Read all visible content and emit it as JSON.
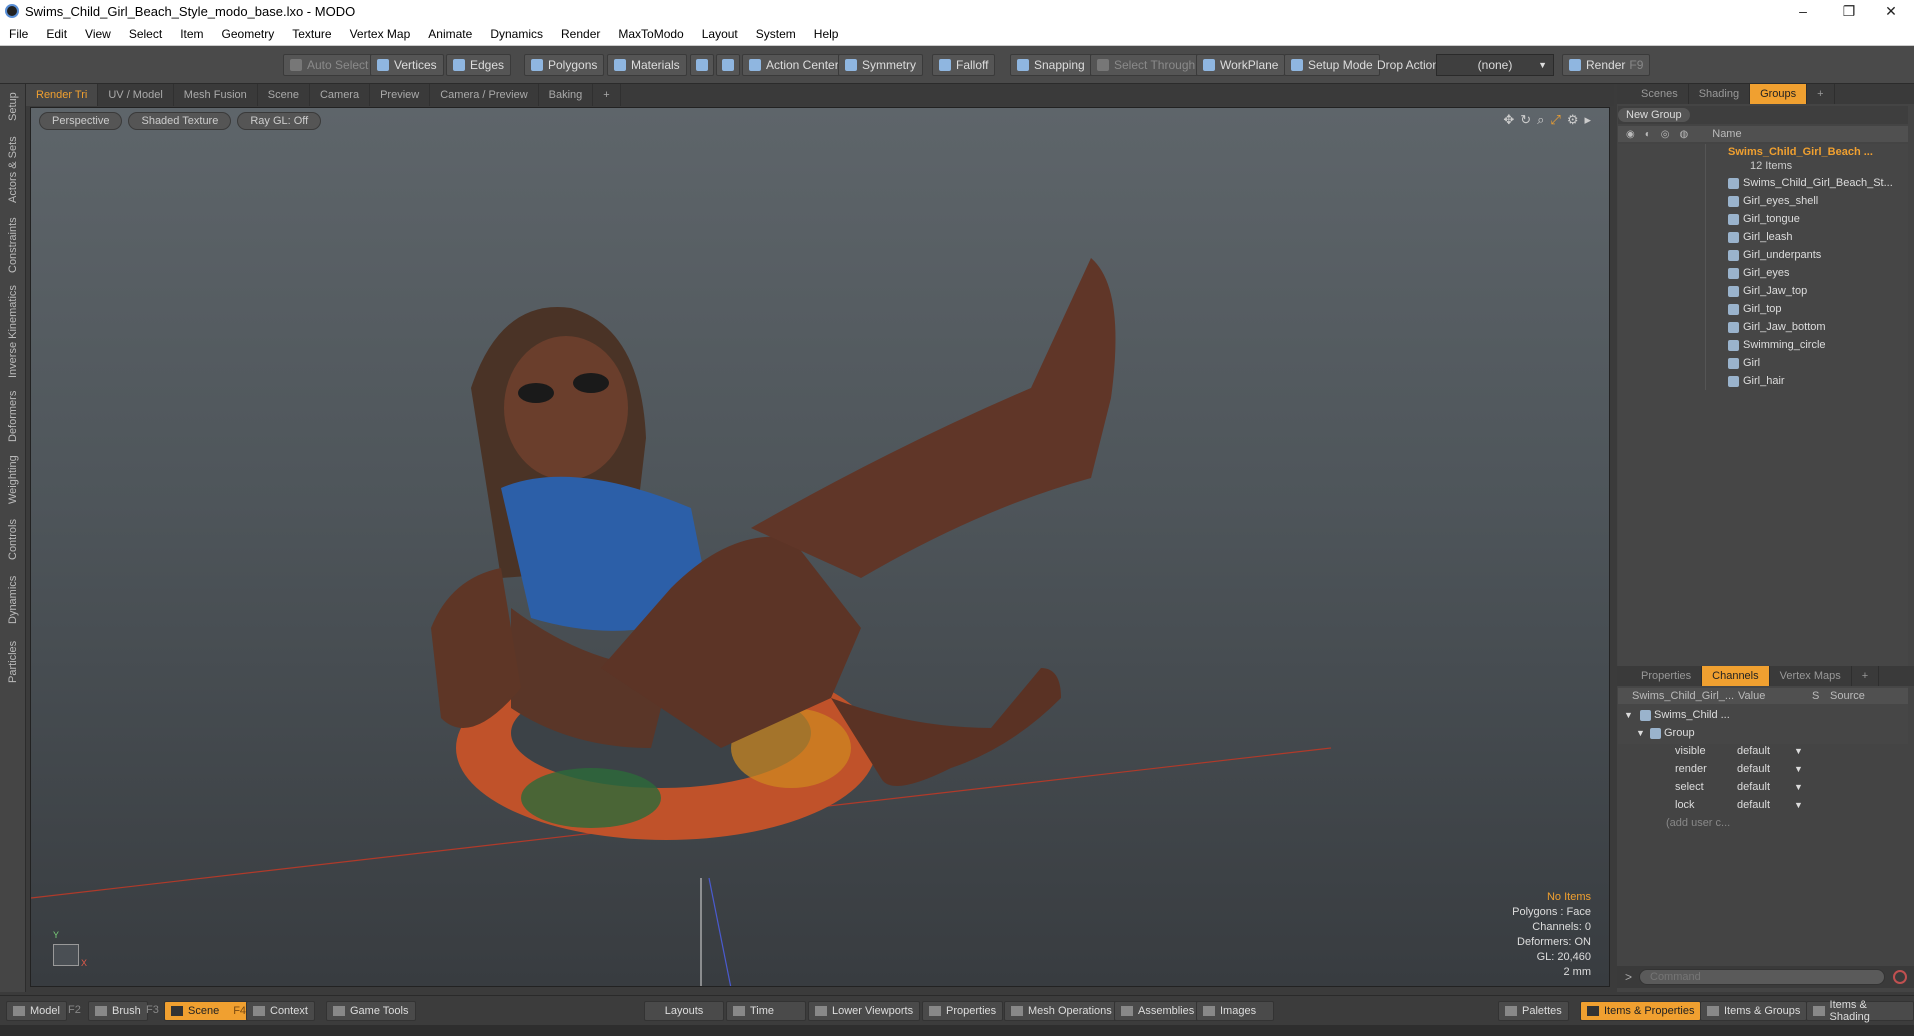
{
  "window": {
    "title": "Swims_Child_Girl_Beach_Style_modo_base.lxo - MODO",
    "minimize": "–",
    "restore": "❐",
    "close": "✕"
  },
  "menu": [
    "File",
    "Edit",
    "View",
    "Select",
    "Item",
    "Geometry",
    "Texture",
    "Vertex Map",
    "Animate",
    "Dynamics",
    "Render",
    "MaxToModo",
    "Layout",
    "System",
    "Help"
  ],
  "toolbar": {
    "auto_select": "Auto Select",
    "vertices": "Vertices",
    "edges": "Edges",
    "polygons": "Polygons",
    "materials": "Materials",
    "action_center": "Action Center",
    "symmetry": "Symmetry",
    "falloff": "Falloff",
    "snapping": "Snapping",
    "select_through": "Select Through",
    "workplane": "WorkPlane",
    "setup_mode": "Setup Mode",
    "drop_action": "Drop Action",
    "drop_value": "(none)",
    "render": "Render",
    "render_key": "F9"
  },
  "left_tabs": [
    "Setup",
    "Actors & Sets",
    "Constraints",
    "Inverse Kinematics",
    "Deformers",
    "Weighting",
    "Controls",
    "Dynamics",
    "Particles"
  ],
  "viewport_tabs": [
    "Render Tri",
    "UV / Model",
    "Mesh Fusion",
    "Scene",
    "Camera",
    "Preview",
    "Camera / Preview",
    "Baking",
    "+"
  ],
  "viewport": {
    "view": "Perspective",
    "shading": "Shaded Texture",
    "raygl": "Ray GL: Off",
    "info": {
      "items": "No Items",
      "polygons": "Polygons : Face",
      "channels": "Channels: 0",
      "deformers": "Deformers: ON",
      "gl": "GL: 20,460",
      "scale": "2 mm"
    },
    "axis_y": "Y",
    "axis_x": "X"
  },
  "scene_panel": {
    "tabs": [
      "Scenes",
      "Shading",
      "Groups",
      "+"
    ],
    "new_group": "New Group",
    "name_header": "Name",
    "group_name": "Swims_Child_Girl_Beach ...",
    "group_count": "12 Items",
    "items": [
      "Swims_Child_Girl_Beach_St...",
      "Girl_eyes_shell",
      "Girl_tongue",
      "Girl_leash",
      "Girl_underpants",
      "Girl_eyes",
      "Girl_Jaw_top",
      "Girl_top",
      "Girl_Jaw_bottom",
      "Swimming_circle",
      "Girl",
      "Girl_hair"
    ]
  },
  "props_panel": {
    "tabs": [
      "Properties",
      "Channels",
      "Vertex Maps",
      "+"
    ],
    "headers": {
      "name": "Swims_Child_Girl_...",
      "value": "Value",
      "s": "S",
      "source": "Source"
    },
    "root": "Swims_Child ...",
    "group": "Group",
    "channels": [
      {
        "key": "visible",
        "value": "default"
      },
      {
        "key": "render",
        "value": "default"
      },
      {
        "key": "select",
        "value": "default"
      },
      {
        "key": "lock",
        "value": "default"
      }
    ],
    "add_user": "(add user c..."
  },
  "command": {
    "placeholder": "Command",
    "prompt": ">"
  },
  "statusbar": {
    "model": "Model",
    "f2": "F2",
    "brush": "Brush",
    "f3": "F3",
    "scene": "Scene",
    "f4": "F4",
    "context": "Context",
    "game_tools": "Game Tools",
    "layouts": "Layouts",
    "time": "Time",
    "lower_viewports": "Lower Viewports",
    "properties": "Properties",
    "mesh_operations": "Mesh Operations",
    "assemblies": "Assemblies",
    "images": "Images",
    "palettes": "Palettes",
    "items_properties": "Items & Properties",
    "items_groups": "Items & Groups",
    "items_shading": "Items & Shading"
  },
  "colors": {
    "accent": "#f0a030",
    "background": "#3b3b3b"
  }
}
